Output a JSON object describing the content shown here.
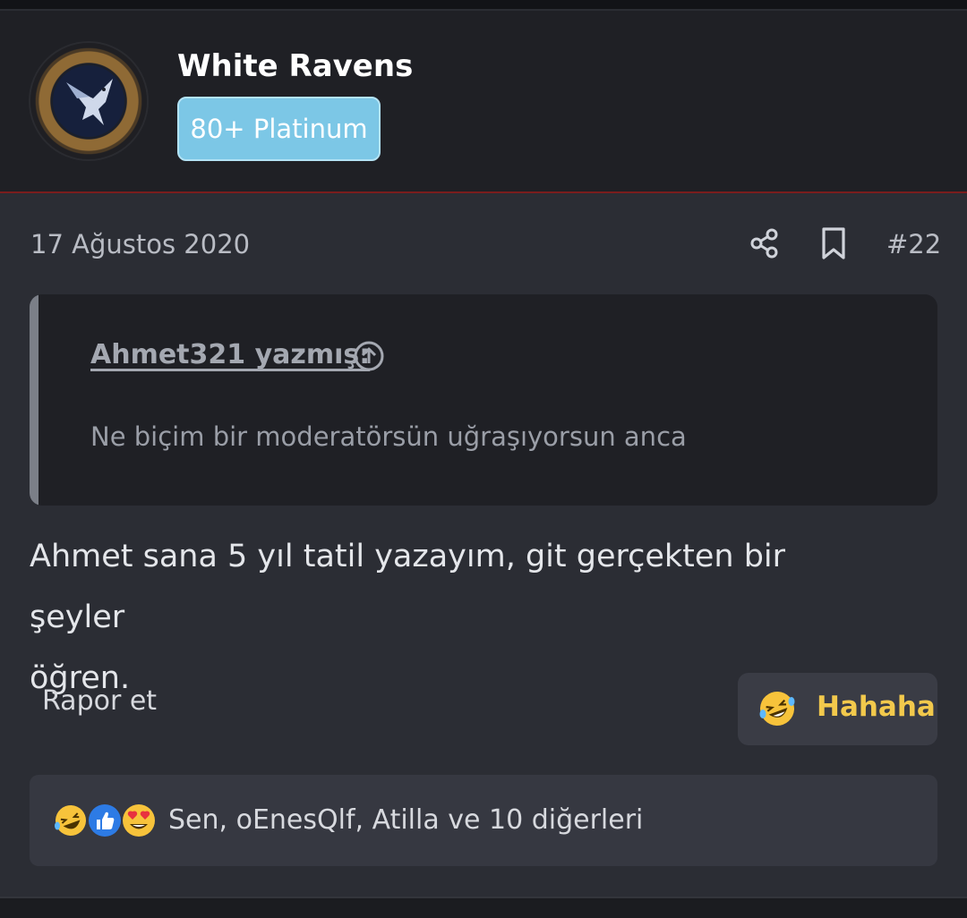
{
  "user": {
    "name": "White Ravens",
    "rank": "80+ Platinum"
  },
  "post": {
    "date": "17 Ağustos 2020",
    "number": "#22",
    "quote": {
      "author": "Ahmet321 yazmış:",
      "text": "Ne biçim bir moderatörsün uğraşıyorsun anca"
    },
    "message_line1": "Ahmet sana 5 yıl tatil yazayım, git gerçekten bir şeyler",
    "message_line2": "öğren.",
    "report_label": "Rapor et",
    "reaction_button_label": "Hahaha",
    "reactions_summary": "Sen, oEnesQlf, Atilla ve 10 diğerleri"
  },
  "icons": {
    "share": "share-icon",
    "bookmark": "bookmark-icon",
    "jump_to_quote": "arrow-up-circle-icon",
    "laugh": "laughing-emoji",
    "like": "thumbs-up-emoji",
    "love": "heart-eyes-emoji"
  },
  "colors": {
    "rank_badge": "#7cc7e6",
    "reaction_highlight": "#f2c94c",
    "header_divider": "#7a1d1d",
    "like_blue": "#2d7be5"
  }
}
